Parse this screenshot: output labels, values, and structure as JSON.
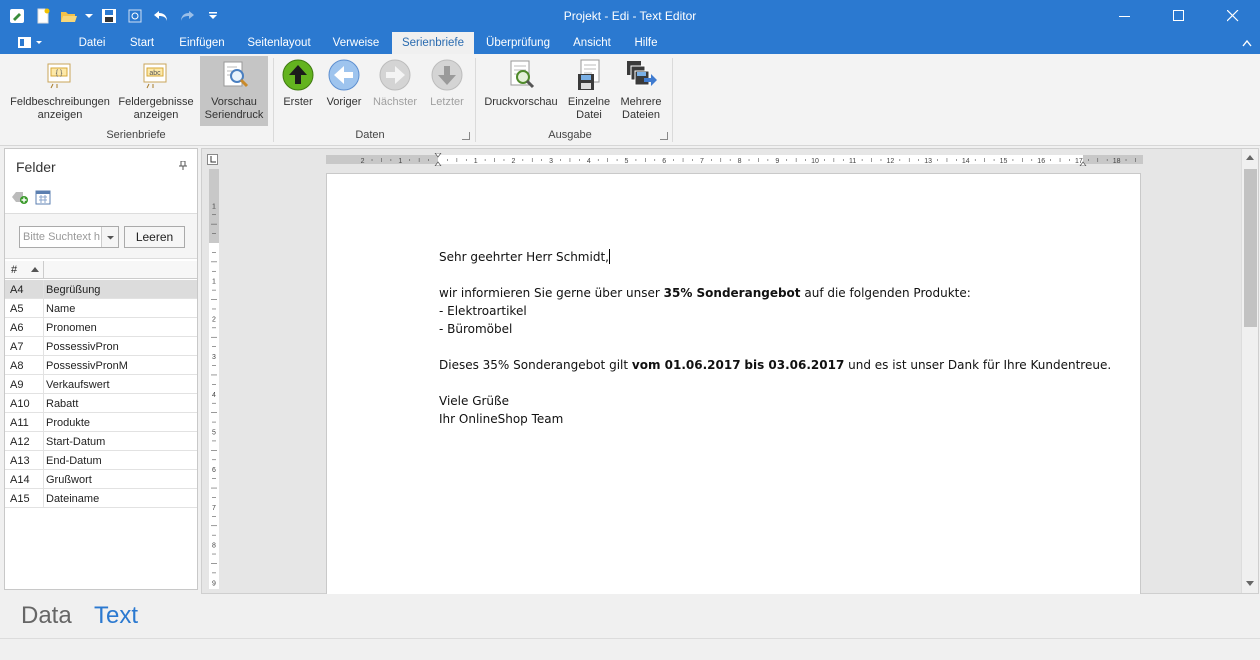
{
  "window": {
    "title": "Projekt - Edi - Text Editor"
  },
  "tabs": [
    "Datei",
    "Start",
    "Einfügen",
    "Seitenlayout",
    "Verweise",
    "Serienbriefe",
    "Überprüfung",
    "Ansicht",
    "Hilfe"
  ],
  "active_tab": "Serienbriefe",
  "ribbon": {
    "fields_desc": "Feldbeschreibungen\nanzeigen",
    "fields_result": "Feldergebnisse\nanzeigen",
    "preview": "Vorschau\nSeriendruck",
    "first": "Erster",
    "prev": "Voriger",
    "next": "Nächster",
    "last": "Letzter",
    "print_preview": "Druckvorschau",
    "single_file": "Einzelne\nDatei",
    "multi_files": "Mehrere\nDateien",
    "group_serienbriefe": "Serienbriefe",
    "group_daten": "Daten",
    "group_ausgabe": "Ausgabe"
  },
  "panel": {
    "title": "Felder",
    "search_placeholder": "Bitte Suchtext h",
    "clear_label": "Leeren",
    "col_hash": "#",
    "fields": [
      {
        "code": "A4",
        "name": "Begrüßung"
      },
      {
        "code": "A5",
        "name": "Name"
      },
      {
        "code": "A6",
        "name": "Pronomen"
      },
      {
        "code": "A7",
        "name": "PossessivPron"
      },
      {
        "code": "A8",
        "name": "PossessivPronM"
      },
      {
        "code": "A9",
        "name": "Verkaufswert"
      },
      {
        "code": "A10",
        "name": "Rabatt"
      },
      {
        "code": "A11",
        "name": "Produkte"
      },
      {
        "code": "A12",
        "name": "Start-Datum"
      },
      {
        "code": "A13",
        "name": "End-Datum"
      },
      {
        "code": "A14",
        "name": "Grußwort"
      },
      {
        "code": "A15",
        "name": "Dateiname"
      }
    ],
    "selected": "A4"
  },
  "document": {
    "salutation": "Sehr geehrter Herr Schmidt,",
    "intro_pre": "wir informieren Sie gerne über unser ",
    "intro_bold": "35% Sonderangebot",
    "intro_post": " auf die folgenden Produkte:",
    "item1": "- Elektroartikel",
    "item2": "- Büromöbel",
    "valid_pre": "Dieses 35% Sonderangebot gilt ",
    "valid_b1": "vom 01.06.2017",
    "valid_mid": " ",
    "valid_b2": "bis 03.06.2017",
    "valid_post": " und es ist unser Dank für Ihre Kundentreue.",
    "closing": "Viele Grüße",
    "signature": "Ihr OnlineShop Team"
  },
  "bottom_tabs": {
    "data": "Data",
    "text": "Text"
  },
  "colors": {
    "accent": "#2b79d0",
    "active_bottom_tab": "#2b79d0"
  }
}
